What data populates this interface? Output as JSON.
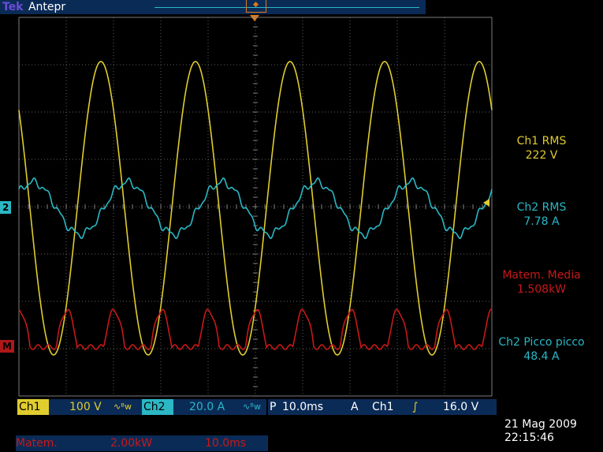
{
  "header": {
    "brand": "Tek",
    "mode": "Antepr"
  },
  "markers": {
    "ch2": "2",
    "math": "M"
  },
  "measurements": [
    {
      "label": "Ch1 RMS",
      "value": "222 V"
    },
    {
      "label": "Ch2 RMS",
      "value": "7.78 A"
    },
    {
      "label": "Matem. Media",
      "value": "1.508kW"
    },
    {
      "label": "Ch2 Picco picco",
      "value": "48.4 A"
    }
  ],
  "channels": {
    "ch1": {
      "label": "Ch1",
      "scale": "100 V",
      "bw": "∿ᴮw"
    },
    "ch2": {
      "label": "Ch2",
      "scale": "20.0 A",
      "bw": "∿ᴮw"
    }
  },
  "timebase": {
    "prefix": "P",
    "value": "10.0ms",
    "mode": "A",
    "source": "Ch1",
    "slope": "∫",
    "level": "16.0 V"
  },
  "math": {
    "label": "Matem.",
    "scale": "2.00kW",
    "time": "10.0ms"
  },
  "datetime": {
    "date": "21 Mag 2009",
    "time": "22:15:46"
  },
  "colors": {
    "ch1": "#e0cc2e",
    "ch2": "#29b8c6",
    "math": "#c81818",
    "grid": "#8a8a8a",
    "bar": "#0b2b57"
  },
  "signals": {
    "ch1_peak_divisions": 3.1,
    "ch1_cycles_per_screen": 5,
    "ch2_amplitude_divisions": 0.55,
    "math_peak_divisions": 2.6
  }
}
